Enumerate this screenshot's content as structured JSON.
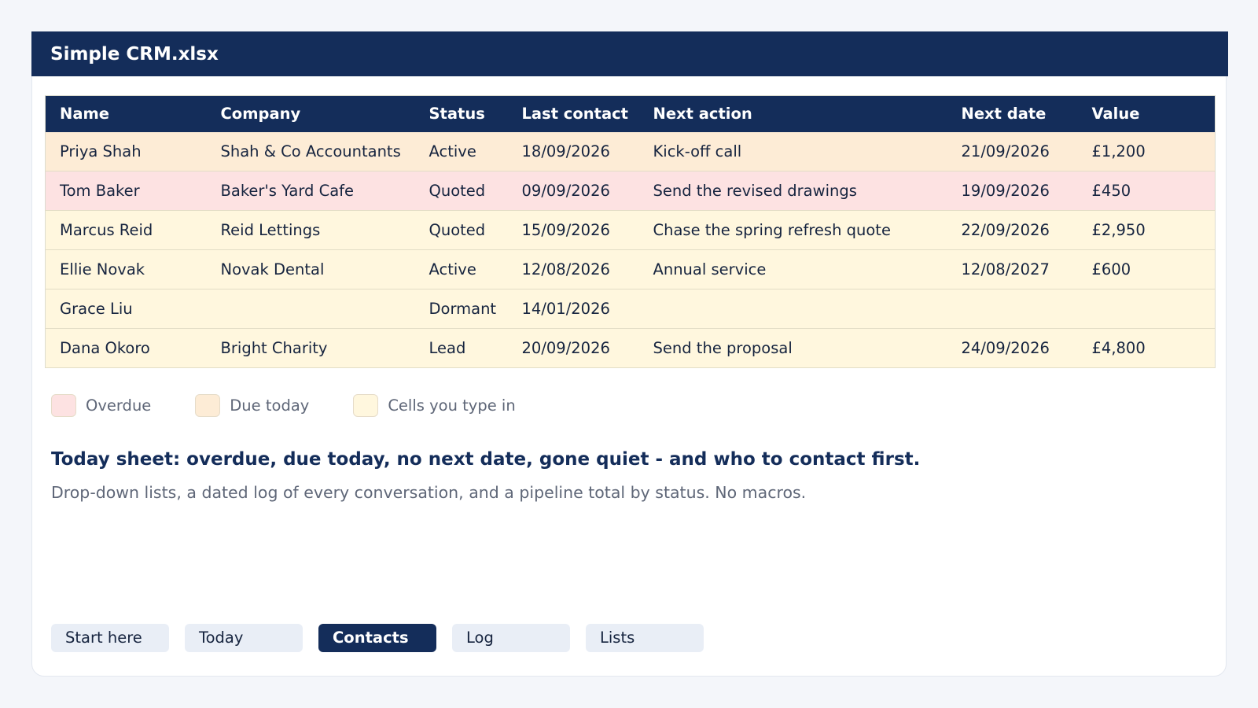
{
  "window": {
    "title": "Simple CRM.xlsx"
  },
  "colors": {
    "header": "#142d5a",
    "due_today": "#fdecd6",
    "overdue": "#fde2e2",
    "input_cell": "#fff7de",
    "tab_inactive": "#e9eef6",
    "tab_active": "#142d5a"
  },
  "table": {
    "columns": [
      "Name",
      "Company",
      "Status",
      "Last contact",
      "Next action",
      "Next date",
      "Value"
    ],
    "rows": [
      {
        "state": "due_today",
        "cells": [
          "Priya Shah",
          "Shah & Co Accountants",
          "Active",
          "18/09/2026",
          "Kick-off call",
          "21/09/2026",
          "£1,200"
        ]
      },
      {
        "state": "overdue",
        "cells": [
          "Tom Baker",
          "Baker's Yard Cafe",
          "Quoted",
          "09/09/2026",
          "Send the revised drawings",
          "19/09/2026",
          "£450"
        ]
      },
      {
        "state": "input",
        "cells": [
          "Marcus Reid",
          "Reid Lettings",
          "Quoted",
          "15/09/2026",
          "Chase the spring refresh quote",
          "22/09/2026",
          "£2,950"
        ]
      },
      {
        "state": "input",
        "cells": [
          "Ellie Novak",
          "Novak Dental",
          "Active",
          "12/08/2026",
          "Annual service",
          "12/08/2027",
          "£600"
        ]
      },
      {
        "state": "input",
        "cells": [
          "Grace Liu",
          "",
          "Dormant",
          "14/01/2026",
          "",
          "",
          ""
        ]
      },
      {
        "state": "input",
        "cells": [
          "Dana Okoro",
          "Bright Charity",
          "Lead",
          "20/09/2026",
          "Send the proposal",
          "24/09/2026",
          "£4,800"
        ]
      }
    ]
  },
  "legend": {
    "items": [
      {
        "label": "Overdue",
        "color": "#fde2e2"
      },
      {
        "label": "Due today",
        "color": "#fdecd6"
      },
      {
        "label": "Cells you type in",
        "color": "#fff7de"
      }
    ]
  },
  "summary": {
    "headline": "Today sheet: overdue, due today, no next date, gone quiet - and who to contact first.",
    "subline": "Drop-down lists, a dated log of every conversation, and a pipeline total by status. No macros."
  },
  "tabs": [
    {
      "label": "Start here",
      "active": false
    },
    {
      "label": "Today",
      "active": false
    },
    {
      "label": "Contacts",
      "active": true
    },
    {
      "label": "Log",
      "active": false
    },
    {
      "label": "Lists",
      "active": false
    }
  ]
}
